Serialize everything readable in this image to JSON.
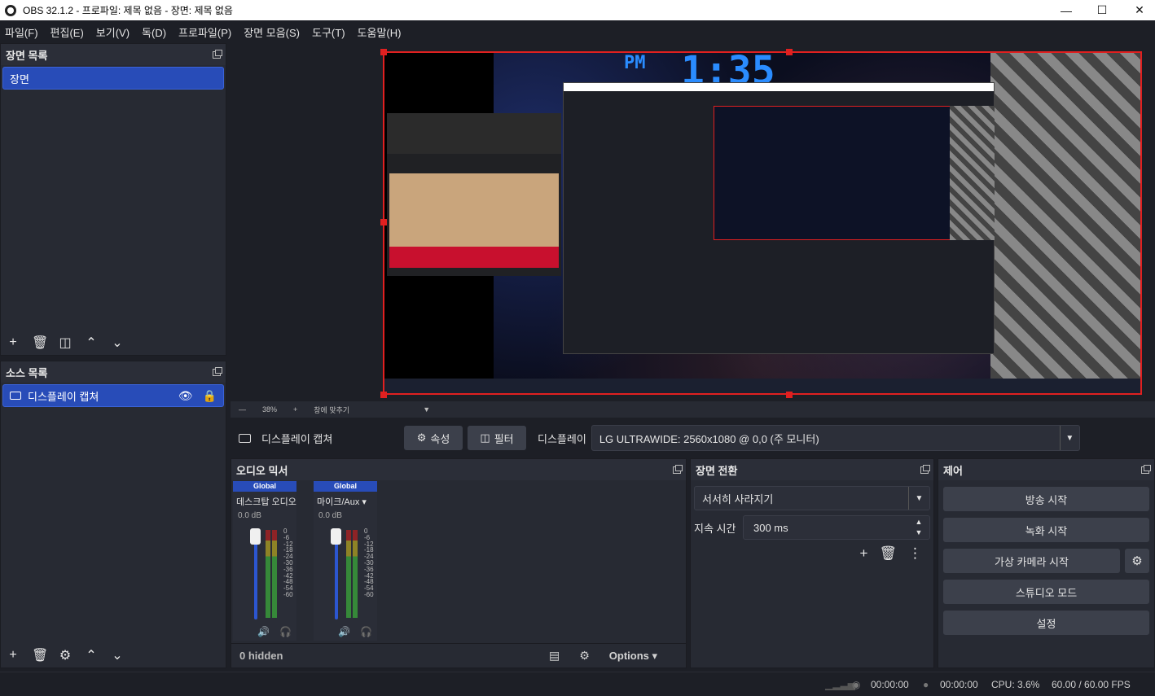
{
  "window": {
    "title": "OBS 32.1.2 - 프로파일: 제목 없음 - 장면: 제목 없음"
  },
  "menu": [
    "파일(F)",
    "편집(E)",
    "보기(V)",
    "독(D)",
    "프로파일(P)",
    "장면 모음(S)",
    "도구(T)",
    "도움말(H)"
  ],
  "scenes": {
    "title": "장면 목록",
    "items": [
      "장면"
    ]
  },
  "sources": {
    "title": "소스 목록",
    "items": [
      "디스플레이 캡쳐"
    ]
  },
  "preview": {
    "zoom": "38%",
    "fit_label": "창에 맞추기",
    "clock_pm": "PM",
    "clock_time": "1:35"
  },
  "source_bar": {
    "name": "디스플레이 캡쳐",
    "properties": "속성",
    "filters": "필터",
    "display_label": "디스플레이",
    "display_value": "LG ULTRAWIDE: 2560x1080 @ 0,0 (주 모니터)"
  },
  "mixer": {
    "title": "오디오 믹서",
    "channels": [
      {
        "tag": "Global",
        "name": "데스크탑 오디오",
        "db": "0.0 dB"
      },
      {
        "tag": "Global",
        "name": "마이크/Aux",
        "db": "0.0 dB"
      }
    ],
    "scale": [
      "0",
      "-6",
      "-12",
      "-18",
      "-24",
      "-30",
      "-36",
      "-42",
      "-48",
      "-54",
      "-60"
    ],
    "hidden": "0 hidden",
    "options": "Options"
  },
  "transitions": {
    "title": "장면 전환",
    "selected": "서서히 사라지기",
    "duration_label": "지속 시간",
    "duration_value": "300 ms"
  },
  "controls": {
    "title": "제어",
    "stream": "방송 시작",
    "record": "녹화 시작",
    "virtual_cam": "가상 카메라 시작",
    "studio": "스튜디오 모드",
    "settings": "설정"
  },
  "status": {
    "stream_time": "00:00:00",
    "record_time": "00:00:00",
    "cpu": "CPU: 3.6%",
    "fps": "60.00 / 60.00 FPS"
  }
}
